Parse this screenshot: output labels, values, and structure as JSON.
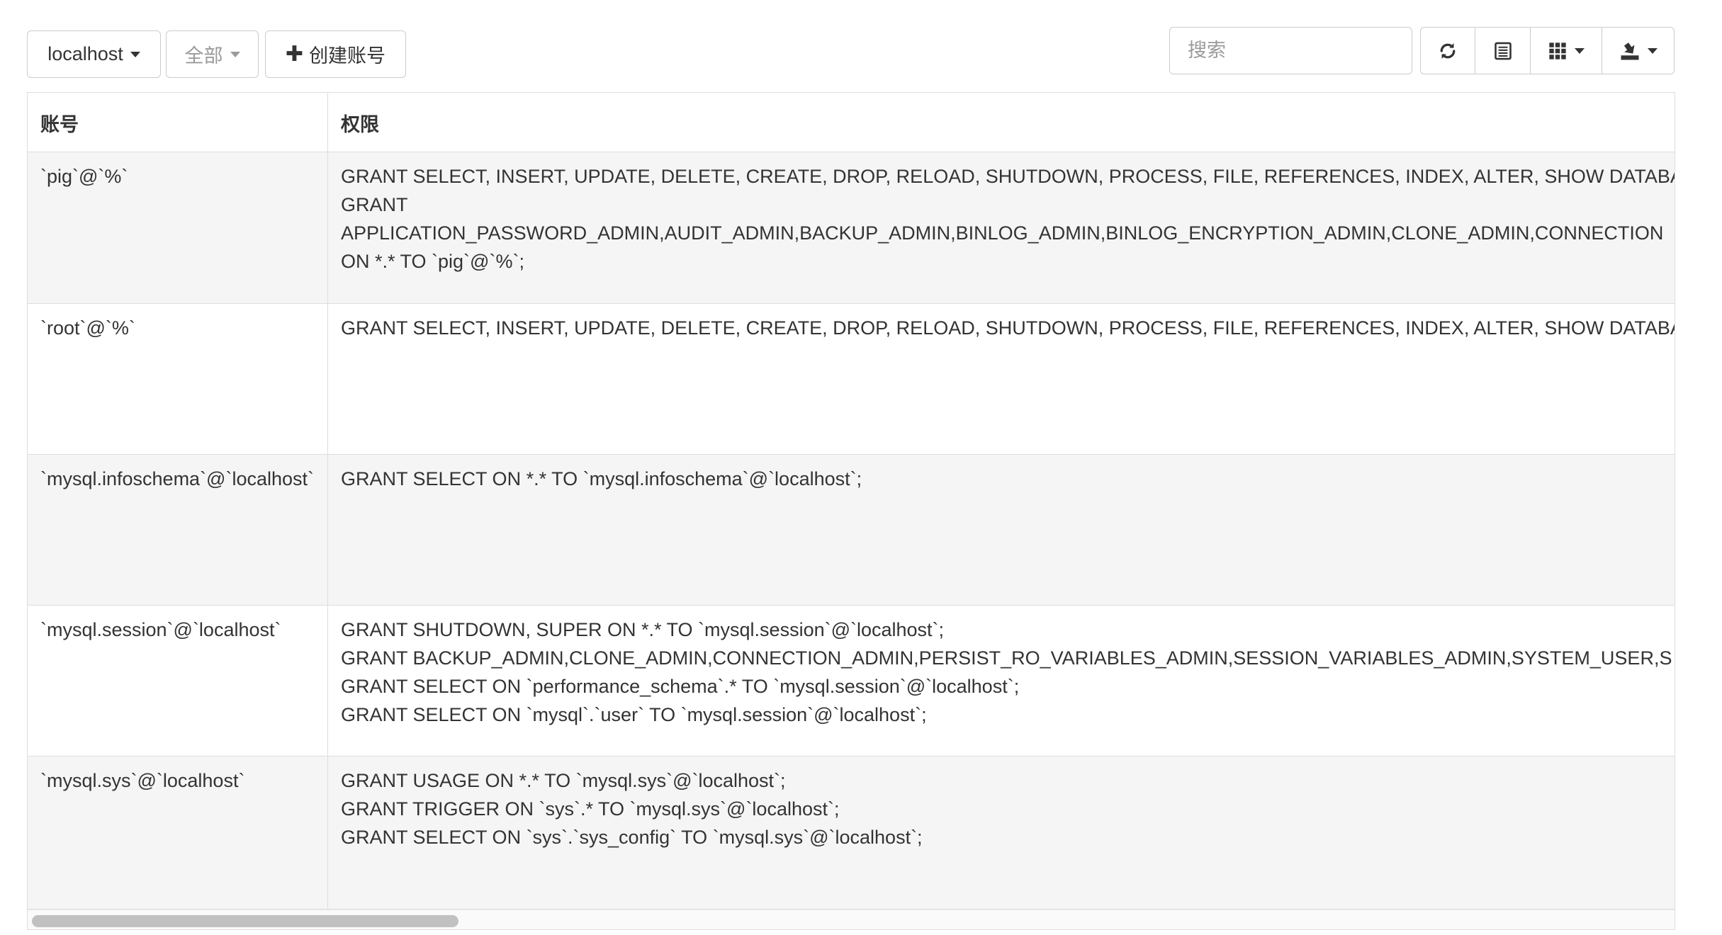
{
  "toolbar": {
    "host_select": "localhost",
    "scope_select": "全部",
    "create_account": "创建账号",
    "search_placeholder": "搜索"
  },
  "table": {
    "headers": [
      "账号",
      "权限"
    ],
    "rows": [
      {
        "account": "`pig`@`%`",
        "grants": [
          "GRANT SELECT, INSERT, UPDATE, DELETE, CREATE, DROP, RELOAD, SHUTDOWN, PROCESS, FILE, REFERENCES, INDEX, ALTER, SHOW DATABA",
          "GRANT",
          "APPLICATION_PASSWORD_ADMIN,AUDIT_ADMIN,BACKUP_ADMIN,BINLOG_ADMIN,BINLOG_ENCRYPTION_ADMIN,CLONE_ADMIN,CONNECTION",
          "ON *.* TO `pig`@`%`;"
        ]
      },
      {
        "account": "`root`@`%`",
        "grants": [
          "GRANT SELECT, INSERT, UPDATE, DELETE, CREATE, DROP, RELOAD, SHUTDOWN, PROCESS, FILE, REFERENCES, INDEX, ALTER, SHOW DATABA"
        ]
      },
      {
        "account": "`mysql.infoschema`@`localhost`",
        "grants": [
          "GRANT SELECT ON *.* TO `mysql.infoschema`@`localhost`;"
        ]
      },
      {
        "account": "`mysql.session`@`localhost`",
        "grants": [
          "GRANT SHUTDOWN, SUPER ON *.* TO `mysql.session`@`localhost`;",
          "GRANT BACKUP_ADMIN,CLONE_ADMIN,CONNECTION_ADMIN,PERSIST_RO_VARIABLES_ADMIN,SESSION_VARIABLES_ADMIN,SYSTEM_USER,S",
          "GRANT SELECT ON `performance_schema`.* TO `mysql.session`@`localhost`;",
          "GRANT SELECT ON `mysql`.`user` TO `mysql.session`@`localhost`;"
        ]
      },
      {
        "account": "`mysql.sys`@`localhost`",
        "grants": [
          "GRANT USAGE ON *.* TO `mysql.sys`@`localhost`;",
          "GRANT TRIGGER ON `sys`.* TO `mysql.sys`@`localhost`;",
          "GRANT SELECT ON `sys`.`sys_config` TO `mysql.sys`@`localhost`;"
        ]
      }
    ]
  },
  "icons": {
    "refresh": "refresh-icon",
    "toggle_view": "list-view-icon",
    "columns": "columns-grid-icon",
    "export": "export-icon"
  }
}
